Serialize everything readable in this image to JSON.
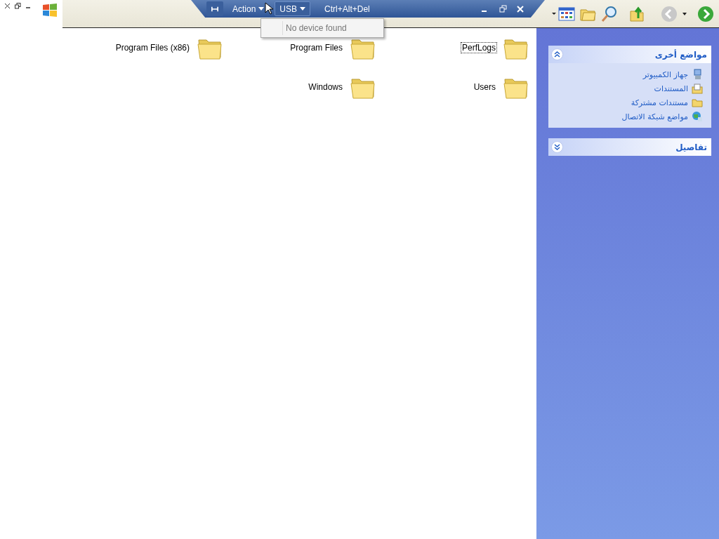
{
  "remote_bar": {
    "action_button": {
      "label": "Action",
      "expanded": false
    },
    "usb_button": {
      "label": "USB",
      "expanded": true
    },
    "shortcut": "Ctrl+Alt+Del",
    "usb_menu": {
      "items": [
        {
          "label": "No device found",
          "disabled": true
        }
      ]
    }
  },
  "toolbar": {
    "back_disabled": true
  },
  "folders": [
    {
      "name": "PerfLogs",
      "selected": true
    },
    {
      "name": "Program Files",
      "selected": false
    },
    {
      "name": "Program Files (x86)",
      "selected": false
    },
    {
      "name": "Users",
      "selected": false
    },
    {
      "name": "Windows",
      "selected": false
    }
  ],
  "sidebar": {
    "panels": [
      {
        "title": "مواضع أخرى",
        "expanded": true,
        "items": [
          {
            "label": "جهاز الكمبيوتر",
            "kind": "computer"
          },
          {
            "label": "المستندات",
            "kind": "documents"
          },
          {
            "label": "مستندات مشتركة",
            "kind": "folder"
          },
          {
            "label": "مواضع شبكة الاتصال",
            "kind": "network"
          }
        ]
      },
      {
        "title": "تفاصيل",
        "expanded": false
      }
    ]
  }
}
